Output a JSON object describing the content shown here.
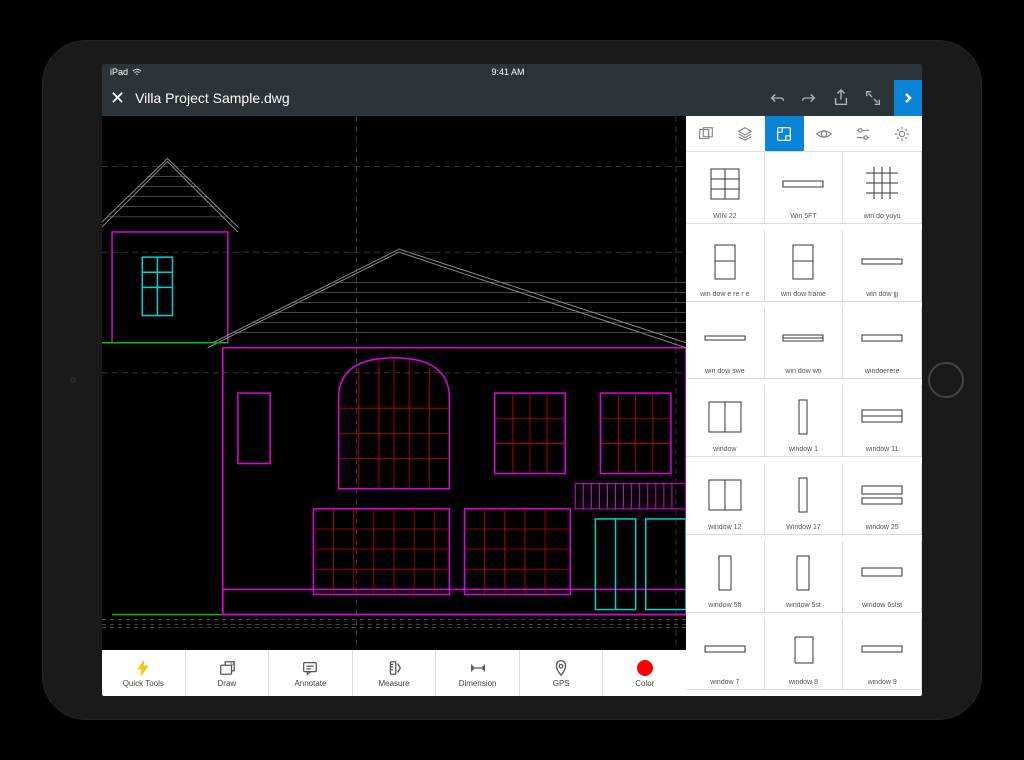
{
  "status": {
    "carrier": "iPad",
    "time": "9:41 AM"
  },
  "titlebar": {
    "filename": "Villa Project Sample.dwg"
  },
  "bottom_tools": [
    {
      "label": "Quick Tools"
    },
    {
      "label": "Draw"
    },
    {
      "label": "Annotate"
    },
    {
      "label": "Measure"
    },
    {
      "label": "Dimension"
    },
    {
      "label": "GPS"
    },
    {
      "label": "Color"
    }
  ],
  "blocks": [
    {
      "label": "WIN 22"
    },
    {
      "label": "Win 5FT"
    },
    {
      "label": "win do yuyu"
    },
    {
      "label": "win dow e re r e"
    },
    {
      "label": "win dow frame"
    },
    {
      "label": "win dow jjj"
    },
    {
      "label": "win dow swe"
    },
    {
      "label": "win dow wo"
    },
    {
      "label": "windoerere"
    },
    {
      "label": "window"
    },
    {
      "label": "window 1"
    },
    {
      "label": "window 11"
    },
    {
      "label": "window 12"
    },
    {
      "label": "Window 17"
    },
    {
      "label": "window 25"
    },
    {
      "label": "window 5ft"
    },
    {
      "label": "window 5st"
    },
    {
      "label": "window 6stst"
    },
    {
      "label": "window 7"
    },
    {
      "label": "window 8"
    },
    {
      "label": "window 9"
    }
  ],
  "colors": {
    "accent": "#0a84d8",
    "canvas_magenta": "#e000e0",
    "canvas_cyan": "#00d0d0",
    "canvas_green": "#00c000"
  }
}
